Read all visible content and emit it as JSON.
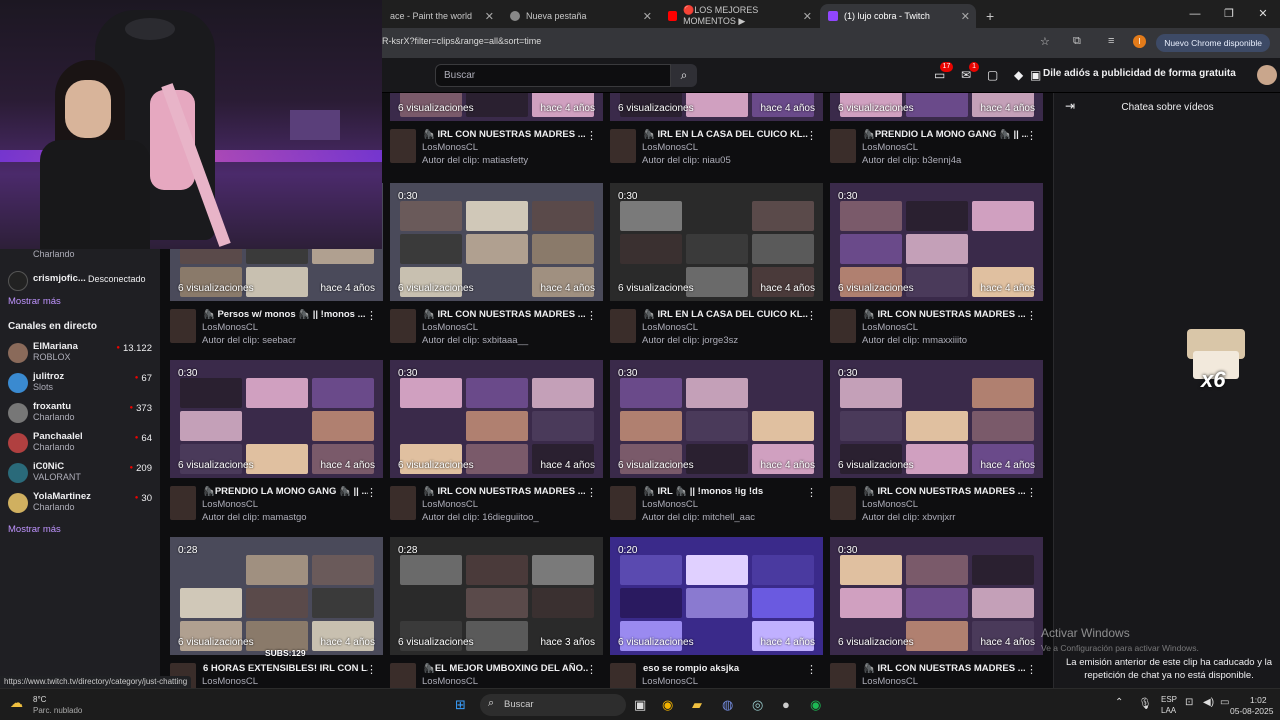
{
  "browser": {
    "tabs": [
      {
        "title": "ace - Paint the world",
        "active": false
      },
      {
        "title": "Nueva pestaña",
        "active": false
      },
      {
        "title": "🔴LOS MEJORES MOMENTOS ▶",
        "active": false
      },
      {
        "title": "(1) lujo cobra - Twitch",
        "active": true
      }
    ],
    "new_tab": "+",
    "url": "R-ksrX?filter=clips&range=all&sort=time",
    "chrome_badge": "Nuevo Chrome disponible",
    "profile_initial": "I",
    "status_url": "https://www.twitch.tv/directory/category/just-chatting"
  },
  "header": {
    "search_placeholder": "Buscar",
    "notif_count": "17",
    "inbox_count": "1",
    "ad_free_label": "Dile adiós a publicidad de forma gratuita"
  },
  "sidebar": {
    "top_items": [
      {
        "name": "",
        "status": "Charlando",
        "viewers": ""
      },
      {
        "name": "crismjofic...",
        "status": "",
        "viewers": "Desconectado"
      }
    ],
    "more_label_1": "Mostrar más",
    "live_title": "Canales en directo",
    "live_channels": [
      {
        "name": "ElMariana",
        "game": "ROBLOX",
        "viewers": "13.122",
        "color": "#8a6a5a"
      },
      {
        "name": "julitroz",
        "game": "Slots",
        "viewers": "67",
        "color": "#3a8ad0"
      },
      {
        "name": "froxantu",
        "game": "Charlando",
        "viewers": "373",
        "color": "#777"
      },
      {
        "name": "Panchaalel",
        "game": "Charlando",
        "viewers": "64",
        "color": "#b04040"
      },
      {
        "name": "iC0NiC",
        "game": "VALORANT",
        "viewers": "209",
        "color": "#2a6a7a"
      },
      {
        "name": "YolaMartinez",
        "game": "Charlando",
        "viewers": "30",
        "color": "#d0b060"
      }
    ],
    "more_label_2": "Mostrar más"
  },
  "clips": [
    {
      "duration": "",
      "views": "6 visualizaciones",
      "ago": "hace 4 años",
      "title": "🦍 IRL CON NUESTRAS MADRES ...",
      "channel": "LosMonosCL",
      "author": "Autor del clip: matiasfetty",
      "col": 1,
      "row": 0,
      "style": "grid"
    },
    {
      "duration": "",
      "views": "6 visualizaciones",
      "ago": "hace 4 años",
      "title": "🦍 IRL EN LA CASA DEL CUICO KL...",
      "channel": "LosMonosCL",
      "author": "Autor del clip: niau05",
      "col": 2,
      "row": 0,
      "style": "grid"
    },
    {
      "duration": "",
      "views": "6 visualizaciones",
      "ago": "hace 4 años",
      "title": "🦍PRENDIO LA MONO GANG 🦍 || ...",
      "channel": "LosMonosCL",
      "author": "Autor del clip: b3ennj4a",
      "col": 3,
      "row": 0,
      "style": "grid"
    },
    {
      "duration": "",
      "views": "6 visualizaciones",
      "ago": "hace 4 años",
      "title": "🦍 Persos w/ monos 🦍 || !monos ...",
      "channel": "LosMonosCL",
      "author": "Autor del clip: seebacr",
      "col": 0,
      "row": 1,
      "style": "room"
    },
    {
      "duration": "0:30",
      "views": "6 visualizaciones",
      "ago": "hace 4 años",
      "title": "🦍 IRL CON NUESTRAS MADRES ...",
      "channel": "LosMonosCL",
      "author": "Autor del clip: sxbitaaa__",
      "col": 1,
      "row": 1,
      "style": "room"
    },
    {
      "duration": "0:30",
      "views": "6 visualizaciones",
      "ago": "hace 4 años",
      "title": "🦍 IRL EN LA CASA DEL CUICO KL...",
      "channel": "LosMonosCL",
      "author": "Autor del clip: jorge3sz",
      "col": 2,
      "row": 1,
      "style": "dark"
    },
    {
      "duration": "0:30",
      "views": "6 visualizaciones",
      "ago": "hace 4 años",
      "title": "🦍 IRL CON NUESTRAS MADRES ...",
      "channel": "LosMonosCL",
      "author": "Autor del clip: mmaxxiiito",
      "col": 3,
      "row": 1,
      "style": "grid"
    },
    {
      "duration": "0:30",
      "views": "6 visualizaciones",
      "ago": "hace 4 años",
      "title": "🦍PRENDIO LA MONO GANG 🦍 || ...",
      "channel": "LosMonosCL",
      "author": "Autor del clip: mamastgo",
      "col": 0,
      "row": 2,
      "style": "grid"
    },
    {
      "duration": "0:30",
      "views": "6 visualizaciones",
      "ago": "hace 4 años",
      "title": "🦍 IRL CON NUESTRAS MADRES ...",
      "channel": "LosMonosCL",
      "author": "Autor del clip: 16dieguiitoo_",
      "col": 1,
      "row": 2,
      "style": "grid"
    },
    {
      "duration": "0:30",
      "views": "6 visualizaciones",
      "ago": "hace 4 años",
      "title": "🦍 IRL 🦍 || !monos !ig !ds",
      "channel": "LosMonosCL",
      "author": "Autor del clip: mitchell_aac",
      "col": 2,
      "row": 2,
      "style": "grid"
    },
    {
      "duration": "0:30",
      "views": "6 visualizaciones",
      "ago": "hace 4 años",
      "title": "🦍 IRL CON NUESTRAS MADRES ...",
      "channel": "LosMonosCL",
      "author": "Autor del clip: xbvnjxrr",
      "col": 3,
      "row": 2,
      "style": "grid"
    },
    {
      "duration": "0:28",
      "views": "6 visualizaciones",
      "ago": "hace 4 años",
      "title": "6 HORAS EXTENSIBLES! IRL CON L...",
      "channel": "LosMonosCL",
      "author": "",
      "col": 0,
      "row": 3,
      "style": "room"
    },
    {
      "duration": "0:28",
      "views": "6 visualizaciones",
      "ago": "hace 3 años",
      "title": "🦍EL MEJOR UMBOXING DEL AÑO...",
      "channel": "LosMonosCL",
      "author": "",
      "col": 1,
      "row": 3,
      "style": "dark"
    },
    {
      "duration": "0:20",
      "views": "6 visualizaciones",
      "ago": "hace 4 años",
      "title": "eso se rompio aksjka",
      "channel": "LosMonosCL",
      "author": "",
      "col": 2,
      "row": 3,
      "style": "purple"
    },
    {
      "duration": "0:30",
      "views": "6 visualizaciones",
      "ago": "hace 4 años",
      "title": "🦍 IRL CON NUESTRAS MADRES ...",
      "channel": "LosMonosCL",
      "author": "",
      "col": 3,
      "row": 3,
      "style": "grid"
    }
  ],
  "chat": {
    "title": "Chatea sobre vídeos",
    "message": "La emisión anterior de este clip ha caducado y la repetición de chat ya no está disponible."
  },
  "watermark": {
    "line1": "Activar Windows",
    "line2": "Ve a Configuración para activar Windows."
  },
  "overlay": {
    "sticker_text": "x6",
    "subs_label": "SUBS:129"
  },
  "taskbar": {
    "weather_temp": "8°C",
    "weather_desc": "Parc. nublado",
    "search_label": "Buscar",
    "lang_1": "ESP",
    "lang_2": "LAA",
    "time": "1:02",
    "date": "05-08-2025"
  }
}
